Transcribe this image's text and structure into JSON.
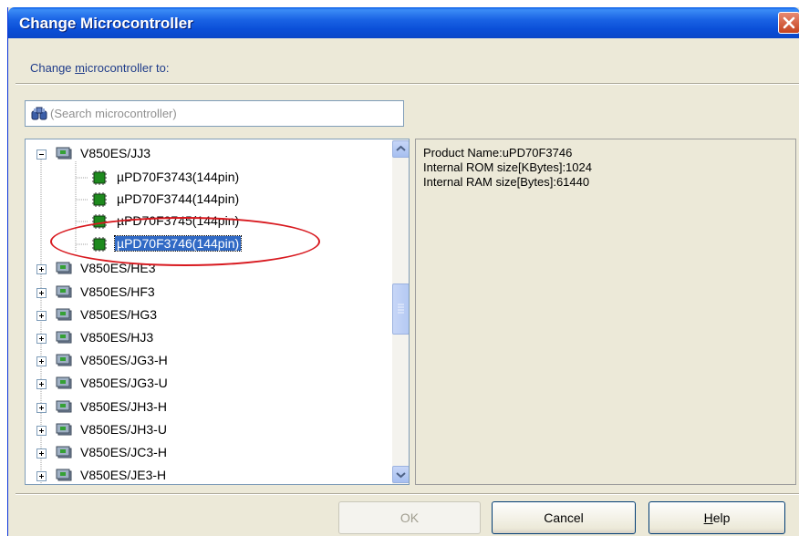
{
  "window": {
    "title": "Change Microcontroller",
    "close_icon": "close-icon"
  },
  "subtitle": {
    "prefix": "Change ",
    "mnemonic": "m",
    "suffix": "icrocontroller to:"
  },
  "search": {
    "placeholder": "(Search microcontroller)",
    "icon": "binoculars-icon"
  },
  "tree": {
    "rows": [
      {
        "label": "V850ES/JJ3",
        "type": "group",
        "expanded": true
      },
      {
        "label": "µPD70F3743(144pin)",
        "type": "device"
      },
      {
        "label": "µPD70F3744(144pin)",
        "type": "device"
      },
      {
        "label": "µPD70F3745(144pin)",
        "type": "device"
      },
      {
        "label": "µPD70F3746(144pin)",
        "type": "device",
        "selected": true
      },
      {
        "label": "V850ES/HE3",
        "type": "group"
      },
      {
        "label": "V850ES/HF3",
        "type": "group"
      },
      {
        "label": "V850ES/HG3",
        "type": "group"
      },
      {
        "label": "V850ES/HJ3",
        "type": "group"
      },
      {
        "label": "V850ES/JG3-H",
        "type": "group"
      },
      {
        "label": "V850ES/JG3-U",
        "type": "group"
      },
      {
        "label": "V850ES/JH3-H",
        "type": "group"
      },
      {
        "label": "V850ES/JH3-U",
        "type": "group"
      },
      {
        "label": "V850ES/JC3-H",
        "type": "group"
      },
      {
        "label": "V850ES/JE3-H",
        "type": "group"
      }
    ]
  },
  "info": {
    "line1": "Product Name:uPD70F3746",
    "line2": "Internal ROM size[KBytes]:1024",
    "line3": "Internal RAM size[Bytes]:61440"
  },
  "buttons": {
    "ok": "OK",
    "cancel": "Cancel",
    "help_mnemonic": "H",
    "help_rest": "elp"
  },
  "colors": {
    "selection": "#316ac5",
    "highlight_ellipse": "#d8191f",
    "titlebar": "#0a5ee8"
  }
}
